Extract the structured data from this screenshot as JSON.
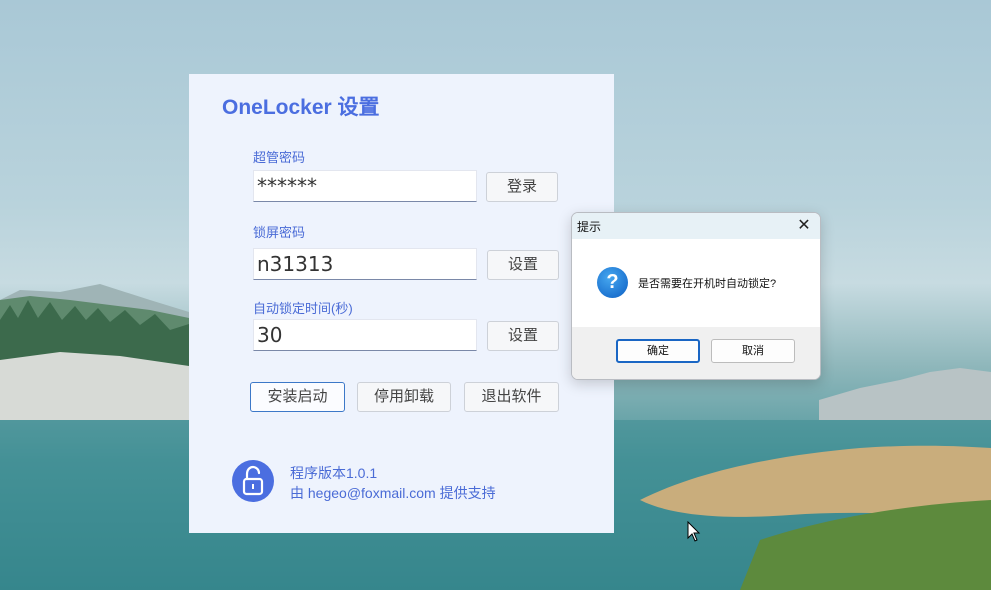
{
  "app": {
    "title": "OneLocker 设置",
    "super_password": {
      "label": "超管密码",
      "value": "******",
      "button": "登录"
    },
    "lock_password": {
      "label": "锁屏密码",
      "value": "n31313",
      "button": "设置"
    },
    "auto_lock": {
      "label": "自动锁定时间(秒)",
      "value": "30",
      "button": "设置"
    },
    "actions": {
      "install": "安装启动",
      "uninstall": "停用卸载",
      "exit": "退出软件"
    },
    "footer": {
      "version": "程序版本1.0.1",
      "support": "由 hegeo@foxmail.com 提供支持"
    },
    "colors": {
      "accent": "#4b6ee0",
      "panel": "#eef3fd"
    }
  },
  "dialog": {
    "title": "提示",
    "message": "是否需要在开机时自动锁定?",
    "ok": "确定",
    "cancel": "取消",
    "icon": "question-icon"
  }
}
